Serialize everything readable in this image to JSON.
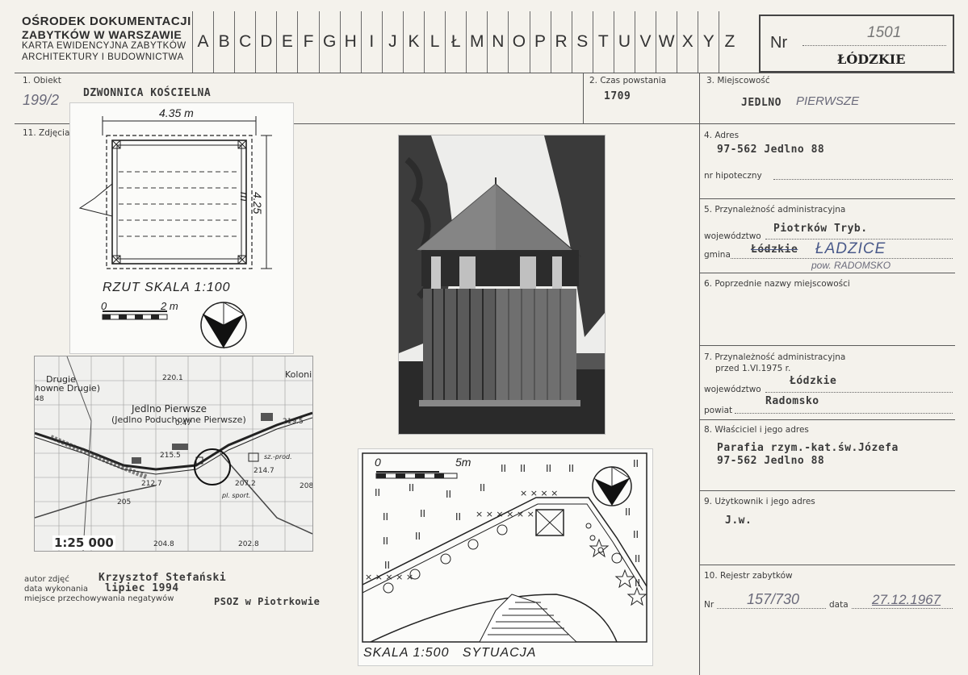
{
  "header": {
    "org_line1": "OŚRODEK DOKUMENTACJI",
    "org_line2": "ZABYTKÓW W WARSZAWIE",
    "org_line3": "KARTA EWIDENCYJNA ZABYTKÓW",
    "org_line4": "ARCHITEKTURY I BUDOWNICTWA",
    "letters": [
      "A",
      "B",
      "C",
      "D",
      "E",
      "F",
      "G",
      "H",
      "I",
      "J",
      "K",
      "L",
      "Ł",
      "M",
      "N",
      "O",
      "P",
      "R",
      "S",
      "T",
      "U",
      "V",
      "W",
      "X",
      "Y",
      "Z"
    ],
    "nr_label": "Nr",
    "nr_value": "1501",
    "voivodeship": "ŁÓDZKIE"
  },
  "obiekt": {
    "label": "1. Obiekt",
    "value": "DZWONNICA KOŚCIELNA",
    "note": "199/2"
  },
  "czas": {
    "label": "2. Czas powstania",
    "value": "1709"
  },
  "miejscowosc": {
    "label": "3. Miejscowość",
    "value": "JEDLNO",
    "hand": "PIERWSZE"
  },
  "zdjecia": {
    "label": "11. Zdjęcia"
  },
  "adres": {
    "label": "4. Adres",
    "value": "97-562 Jedlno 88",
    "hipoteczny_label": "nr hipoteczny"
  },
  "przynaleznosc": {
    "label": "5. Przynależność administracyjna",
    "woj_label": "województwo",
    "woj_value": "Piotrków Tryb.",
    "gmina_label": "gmina",
    "gmina_struck": "Łódzkie",
    "gmina_hand": "ŁADZICE",
    "gmina_hand2": "pow. RADOMSKO"
  },
  "poprzednie": {
    "label": "6. Poprzednie nazwy miejscowości"
  },
  "przynaleznosc_przed": {
    "label": "7. Przynależność administracyjna",
    "label2": "przed 1.VI.1975 r.",
    "woj_label": "województwo",
    "woj_value": "Łódzkie",
    "powiat_label": "powiat",
    "powiat_value": "Radomsko"
  },
  "wlasciciel": {
    "label": "8. Właściciel i jego adres",
    "line1": "Parafia rzym.-kat.św.Józefa",
    "line2": "97-562 Jedlno 88"
  },
  "uzytkownik": {
    "label": "9. Użytkownik i jego adres",
    "value": "J.w."
  },
  "rejestr": {
    "label": "10. Rejestr zabytków",
    "nr_label": "Nr",
    "nr_value": "157/730",
    "data_label": "data",
    "data_value": "27.12.1967"
  },
  "credits": {
    "autor_label": "autor zdjęć",
    "autor_value": "Krzysztof Stefański",
    "data_label": "data wykonania",
    "data_value": "lipiec 1994",
    "miejsce_label": "miejsce przechowywania negatywów",
    "miejsce_value": "PSOZ w Piotrkowie"
  },
  "plan": {
    "width_label": "4.35 m",
    "height_label": "4.25 m",
    "title": "RZUT SKALA 1:100",
    "scale_left": "0",
    "scale_right": "2 m"
  },
  "map": {
    "scale": "1:25 000",
    "labels": [
      "Drugie",
      "howne Drugie)",
      "Jedlno Pierwsze",
      "(Jedlno Poduchowne Pierwsze)",
      "Koloni",
      "220.1",
      "219.5",
      "215.5",
      "214.7",
      "207.2",
      "212.7",
      "205",
      "204.8",
      "202.8",
      "208",
      "0.47",
      "48",
      "sz.-prod.",
      "pl. sport."
    ]
  },
  "situation": {
    "title": "SKALA 1:500   SYTUACJA",
    "scale_left": "0",
    "scale_right": "5m"
  },
  "colors": {
    "paper": "#f4f2ec",
    "line": "#5a5a5a",
    "handwriting": "#4a5a8a"
  }
}
